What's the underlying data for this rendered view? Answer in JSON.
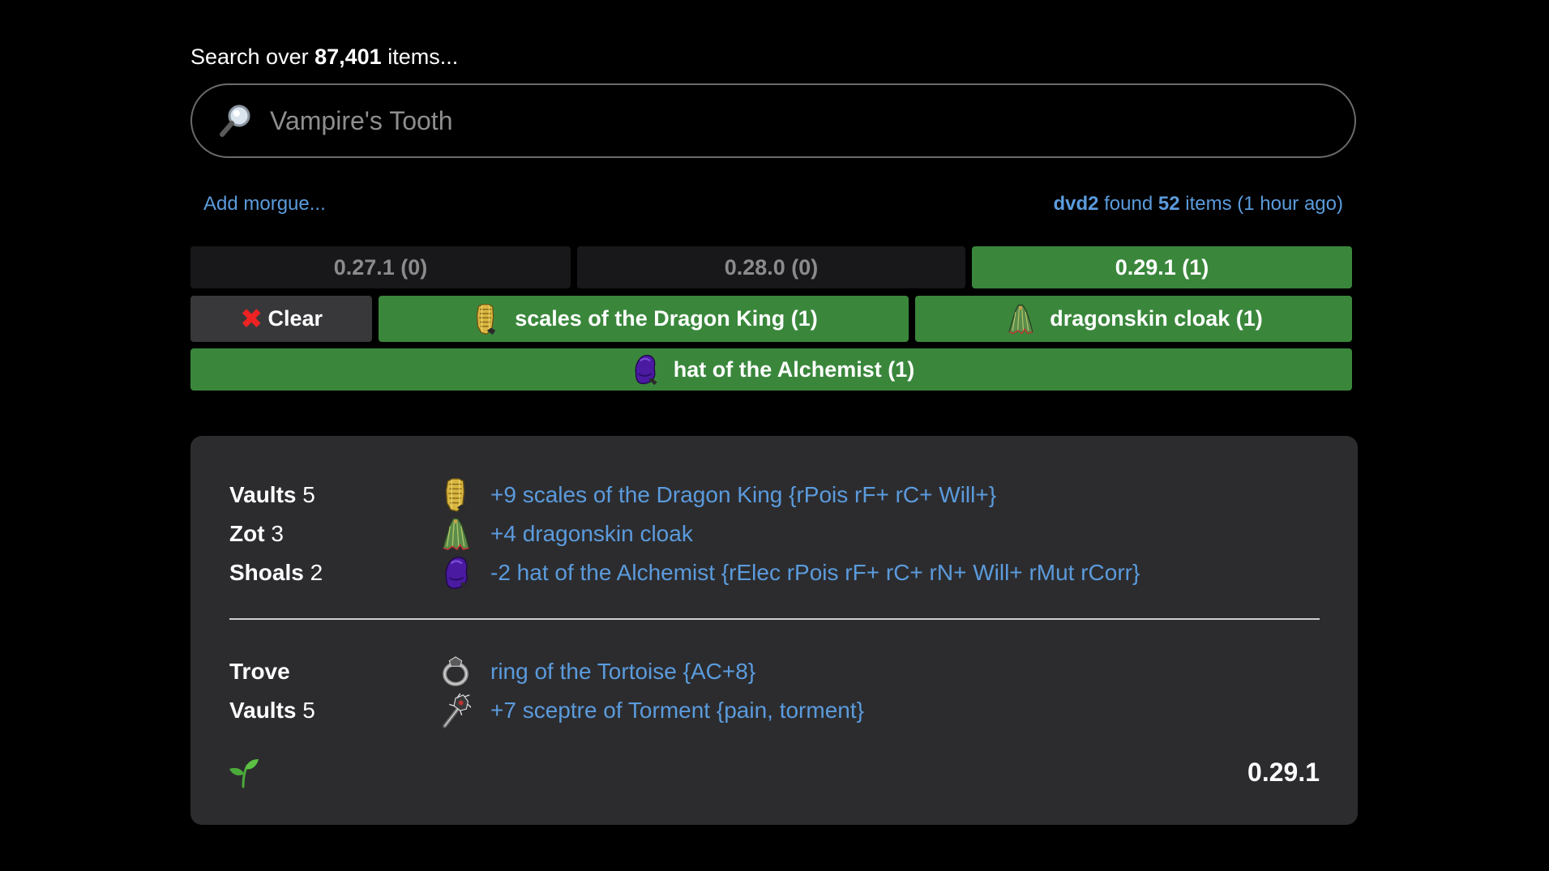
{
  "search": {
    "heading_prefix": "Search over",
    "item_count": "87,401",
    "heading_suffix": "items...",
    "placeholder": "Vampire's Tooth",
    "value": ""
  },
  "status": {
    "add_morgue": "Add morgue...",
    "player": "dvd2",
    "found_word": "found",
    "found_count": "52",
    "found_suffix": "items (1 hour ago)"
  },
  "versions": [
    {
      "label": "0.27.1 (0)",
      "active": false
    },
    {
      "label": "0.28.0 (0)",
      "active": false
    },
    {
      "label": "0.29.1 (1)",
      "active": true
    }
  ],
  "filters": {
    "clear_label": "Clear",
    "items": [
      {
        "label": "scales of the Dragon King (1)",
        "icon": "golden-scale-armour-icon"
      },
      {
        "label": "dragonskin cloak (1)",
        "icon": "green-cloak-icon"
      },
      {
        "label": "hat of the Alchemist (1)",
        "icon": "purple-hat-icon"
      }
    ]
  },
  "results": {
    "group1": [
      {
        "place": "Vaults",
        "level": "5",
        "item": "+9 scales of the Dragon King {rPois rF+ rC+ Will+}",
        "icon": "golden-scale-armour-icon"
      },
      {
        "place": "Zot",
        "level": "3",
        "item": "+4 dragonskin cloak",
        "icon": "green-cloak-icon"
      },
      {
        "place": "Shoals",
        "level": "2",
        "item": "-2 hat of the Alchemist {rElec rPois rF+ rC+ rN+ Will+ rMut rCorr}",
        "icon": "purple-hat-icon"
      }
    ],
    "group2": [
      {
        "place": "Trove",
        "level": "",
        "item": "ring of the Tortoise {AC+8}",
        "icon": "ring-icon"
      },
      {
        "place": "Vaults",
        "level": "5",
        "item": "+7 sceptre of Torment {pain, torment}",
        "icon": "sceptre-icon"
      }
    ],
    "version": "0.29.1",
    "footer_icon": "sprout-icon"
  },
  "colors": {
    "accent_green": "#3a873c",
    "link_blue": "#5b9bdc",
    "panel": "#2c2c2f"
  }
}
